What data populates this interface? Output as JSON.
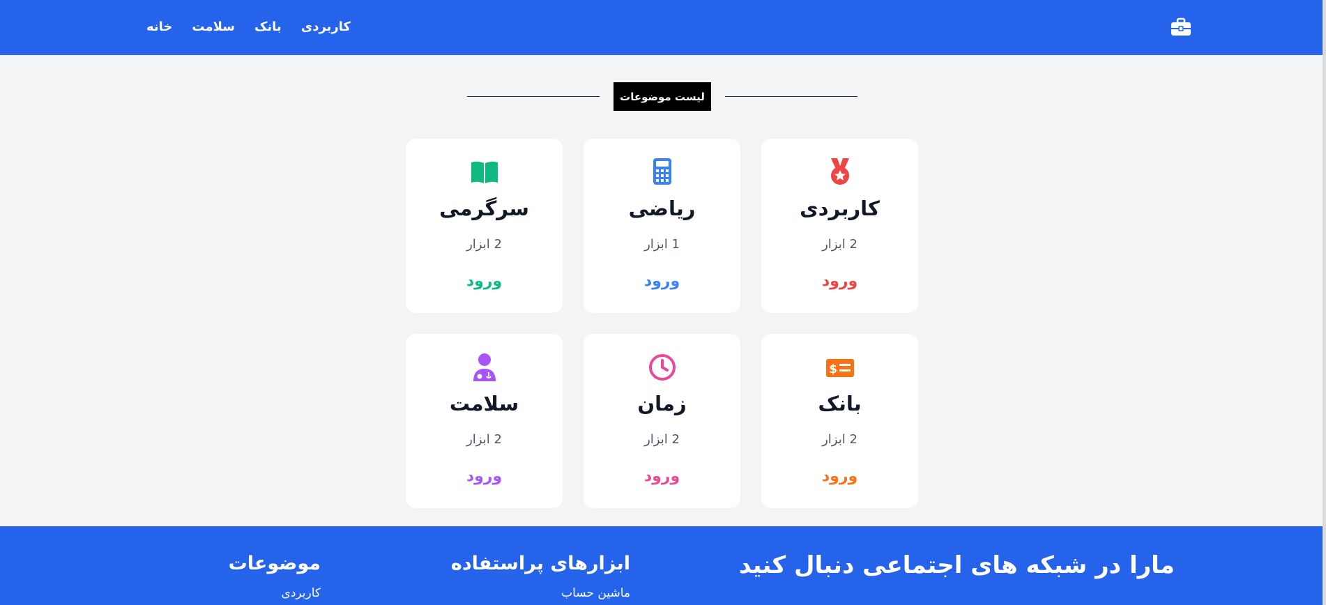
{
  "header": {
    "nav": [
      "خانه",
      "سلامت",
      "بانک",
      "کاربردی"
    ],
    "brand_icon": "briefcase-icon",
    "background": "#2563eb"
  },
  "section": {
    "title": "لیست موضوعات"
  },
  "cards": [
    {
      "title": "کاربردی",
      "count": "2 ابزار",
      "enter": "ورود",
      "icon": "medal-icon",
      "color": "#ef4444"
    },
    {
      "title": "ریاضی",
      "count": "1 ابزار",
      "enter": "ورود",
      "icon": "calculator-icon",
      "color": "#3b82f6"
    },
    {
      "title": "سرگرمی",
      "count": "2 ابزار",
      "enter": "ورود",
      "icon": "book-open-icon",
      "color": "#10b981"
    },
    {
      "title": "بانک",
      "count": "2 ابزار",
      "enter": "ورود",
      "icon": "money-check-icon",
      "color": "#f97316"
    },
    {
      "title": "زمان",
      "count": "2 ابزار",
      "enter": "ورود",
      "icon": "clock-icon",
      "color": "#ec4899"
    },
    {
      "title": "سلامت",
      "count": "2 ابزار",
      "enter": "ورود",
      "icon": "doctor-icon",
      "color": "#a855f7"
    }
  ],
  "footer": {
    "social_title": "مارا در شبکه های اجتماعی دنبال کنید",
    "tools_title": "ابزارهای پراستفاده",
    "tools_link": "ماشین حساب",
    "topics_title": "موضوعات",
    "topics_link": "کاربردی"
  }
}
